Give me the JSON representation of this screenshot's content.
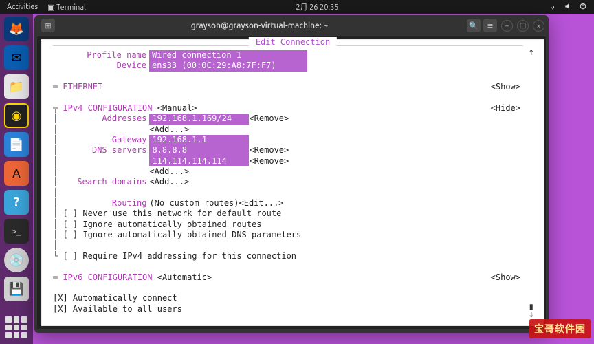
{
  "topbar": {
    "activities": "Activities",
    "app_icon": "terminal-icon",
    "app_name": "Terminal",
    "clock": "2月 26 20:35"
  },
  "window": {
    "title": "grayson@grayson-virtual-machine: ~",
    "new_tab_icon": "plus-icon",
    "search_icon": "search-icon",
    "menu_icon": "hamburger-icon"
  },
  "nmtui": {
    "title": "Edit Connection",
    "profile_name_label": "Profile name",
    "profile_name": "Wired connection 1",
    "device_label": "Device",
    "device": "ens33 (00:0C:29:A8:7F:F7)",
    "ethernet": {
      "header": "ETHERNET",
      "toggle": "<Show>"
    },
    "ipv4": {
      "header": "IPv4 CONFIGURATION",
      "mode": "<Manual>",
      "toggle": "<Hide>",
      "addresses_label": "Addresses",
      "addresses": [
        "192.168.1.169/24"
      ],
      "address_remove": "<Remove>",
      "add": "<Add...>",
      "gateway_label": "Gateway",
      "gateway": "192.168.1.1",
      "dns_label": "DNS servers",
      "dns": [
        "8.8.8.8",
        "114.114.114.114"
      ],
      "dns_remove": "<Remove>",
      "search_domains_label": "Search domains",
      "routing_label": "Routing",
      "routing_value": "(No custom routes)",
      "routing_edit": "<Edit...>",
      "opts": [
        {
          "checked": false,
          "label": "Never use this network for default route"
        },
        {
          "checked": false,
          "label": "Ignore automatically obtained routes"
        },
        {
          "checked": false,
          "label": "Ignore automatically obtained DNS parameters"
        }
      ],
      "require_ipv4": {
        "checked": false,
        "label": "Require IPv4 addressing for this connection"
      }
    },
    "ipv6": {
      "header": "IPv6 CONFIGURATION",
      "mode": "<Automatic>",
      "toggle": "<Show>"
    },
    "general": {
      "auto_connect": {
        "checked": true,
        "label": "Automatically connect"
      },
      "all_users": {
        "checked": true,
        "label": "Available to all users"
      }
    }
  },
  "watermark": "宝哥软件园"
}
